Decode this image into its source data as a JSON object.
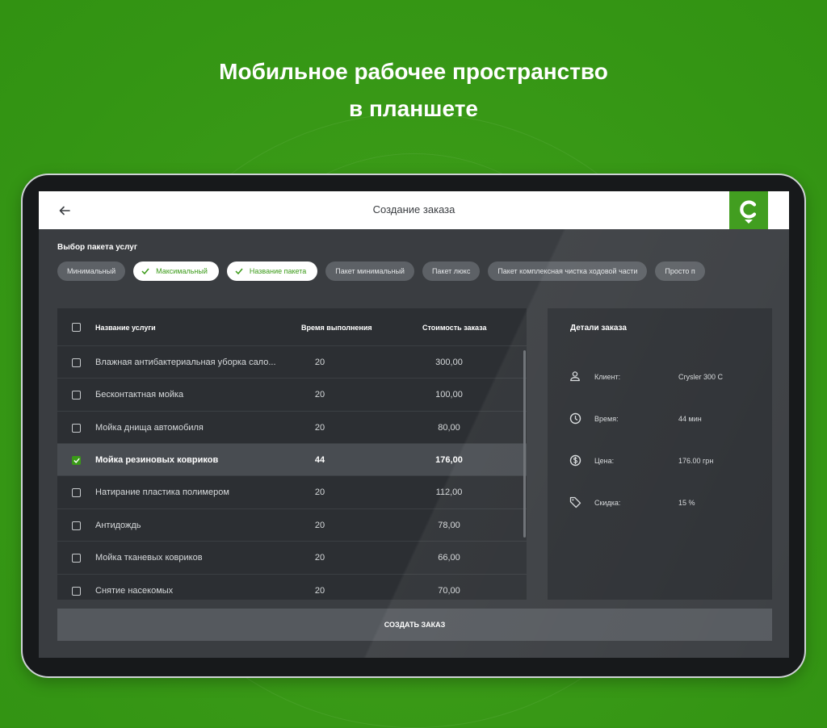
{
  "headline": {
    "line1": "Мобильное рабочее пространство",
    "line2": "в планшете"
  },
  "appbar": {
    "title": "Создание заказа",
    "back_icon": "arrow-left-icon",
    "logo_letter": "C"
  },
  "packages": {
    "label": "Выбор пакета услуг",
    "chips": [
      {
        "label": "Минимальный",
        "selected": false
      },
      {
        "label": "Максимальный",
        "selected": true
      },
      {
        "label": "Название пакета",
        "selected": true
      },
      {
        "label": "Пакет минимальный",
        "selected": false
      },
      {
        "label": "Пакет люкс",
        "selected": false
      },
      {
        "label": "Пакет комплексная чистка ходовой части",
        "selected": false
      },
      {
        "label": "Просто п",
        "selected": false
      }
    ]
  },
  "table": {
    "headers": {
      "name": "Название услуги",
      "time": "Время выполнения",
      "price": "Стоимость заказа"
    },
    "rows": [
      {
        "name": "Влажная антибактериальная уборка сало...",
        "time": "20",
        "price": "300,00",
        "checked": false
      },
      {
        "name": "Бесконтактная мойка",
        "time": "20",
        "price": "100,00",
        "checked": false
      },
      {
        "name": "Мойка днища автомобиля",
        "time": "20",
        "price": "80,00",
        "checked": false
      },
      {
        "name": "Мойка резиновых ковриков",
        "time": "44",
        "price": "176,00",
        "checked": true
      },
      {
        "name": "Натирание пластика полимером",
        "time": "20",
        "price": "112,00",
        "checked": false
      },
      {
        "name": "Антидождь",
        "time": "20",
        "price": "78,00",
        "checked": false
      },
      {
        "name": "Мойка тканевых ковриков",
        "time": "20",
        "price": "66,00",
        "checked": false
      },
      {
        "name": "Снятие насекомых",
        "time": "20",
        "price": "70,00",
        "checked": false
      }
    ]
  },
  "details": {
    "title": "Детали заказа",
    "items": [
      {
        "icon": "person-icon",
        "label": "Клиент:",
        "value": "Crysler 300 C"
      },
      {
        "icon": "clock-icon",
        "label": "Время:",
        "value": "44 мин"
      },
      {
        "icon": "dollar-icon",
        "label": "Цена:",
        "value": "176.00 грн"
      },
      {
        "icon": "tag-icon",
        "label": "Скидка:",
        "value": "15 %"
      }
    ]
  },
  "actions": {
    "create_label": "СОЗДАТЬ ЗАКАЗ"
  },
  "colors": {
    "brand_green": "#3a9a17",
    "screen_bg": "#3a3d41",
    "card_bg": "#2c2f33"
  }
}
